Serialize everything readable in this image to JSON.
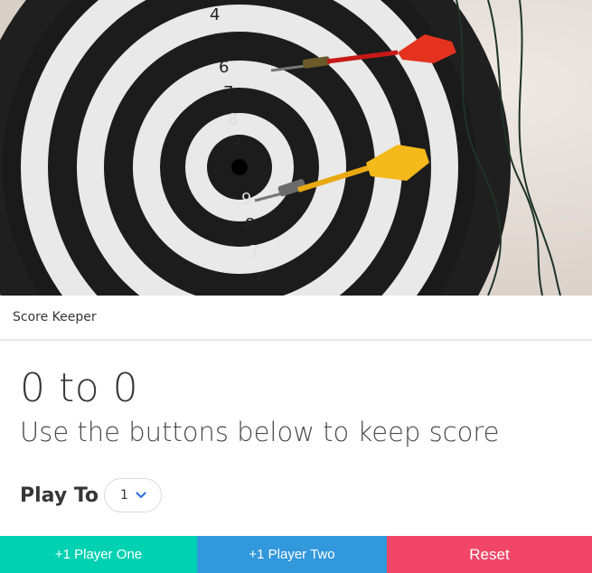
{
  "hero": {
    "image": "dartboard-photo",
    "ring_numbers_upper": [
      "4",
      "5",
      "6",
      "7",
      "8",
      "9"
    ],
    "ring_numbers_lower": [
      "9",
      "8",
      "7",
      "6"
    ]
  },
  "header": {
    "title": "Score Keeper"
  },
  "main": {
    "score": "0 to 0",
    "subtitle": "Use the buttons below to keep score"
  },
  "play_to": {
    "label": "Play To",
    "selected_value": "1",
    "icon": "chevron-down-icon"
  },
  "buttons": {
    "player_one": "+1 Player One",
    "player_two": "+1 Player Two",
    "reset": "Reset"
  },
  "colors": {
    "player_one": "#00d1b2",
    "player_two": "#3298dc",
    "reset": "#f14668",
    "chevron": "#3273dc"
  }
}
